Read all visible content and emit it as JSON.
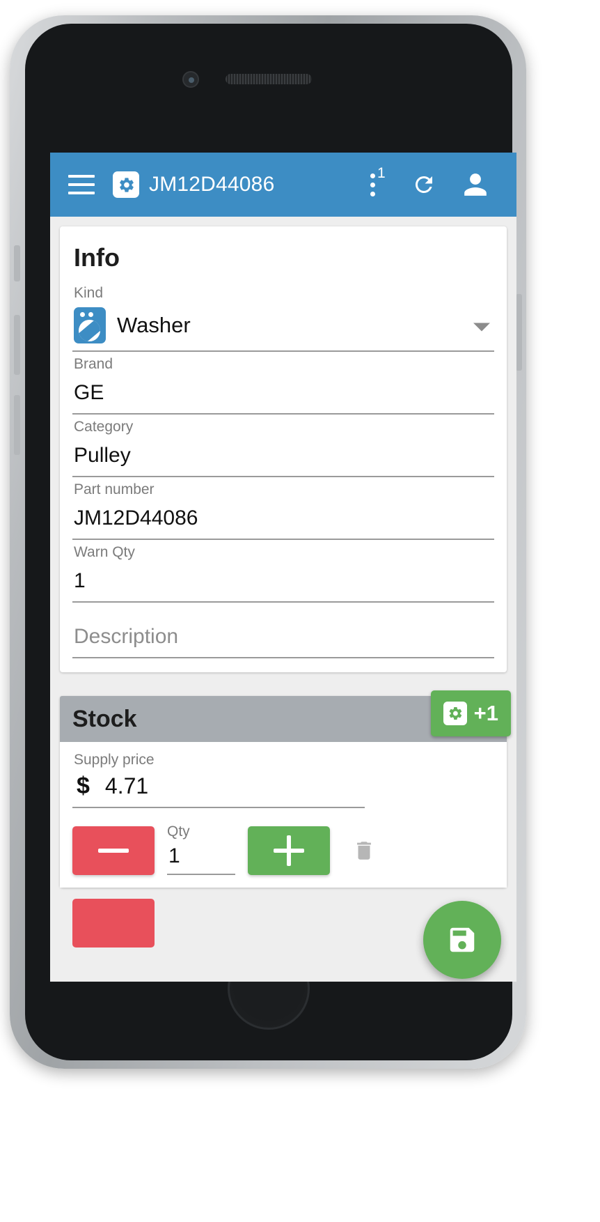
{
  "appbar": {
    "menu_icon": "hamburger-icon",
    "app_icon": "gear-icon",
    "title": "JM12D44086",
    "overflow_icon": "three-dots-icon",
    "overflow_badge": "1",
    "refresh_icon": "refresh-icon",
    "account_icon": "person-icon",
    "background_color": "#3d8dc4"
  },
  "info_card": {
    "title": "Info",
    "fields": [
      {
        "label": "Kind",
        "value": "Washer",
        "icon": "washer-icon",
        "type": "dropdown"
      },
      {
        "label": "Brand",
        "value": "GE",
        "type": "text"
      },
      {
        "label": "Category",
        "value": "Pulley",
        "type": "text"
      },
      {
        "label": "Part number",
        "value": "JM12D44086",
        "type": "text"
      },
      {
        "label": "Warn Qty",
        "value": "1",
        "type": "text"
      }
    ],
    "description_placeholder": "Description",
    "description_value": ""
  },
  "stock_card": {
    "title": "Stock",
    "add_button_label": "+1",
    "add_button_icon": "gear-icon",
    "add_button_color": "#62b158",
    "header_color": "#a7acb1",
    "supply_price_label": "Supply price",
    "currency_symbol": "$",
    "supply_price_value": "4.71",
    "qty_label": "Qty",
    "qty_value": "1",
    "decrement_label": "−",
    "increment_label": "+",
    "decrement_color": "#e8505b",
    "increment_color": "#62b158",
    "delete_icon": "trash-icon"
  },
  "fab": {
    "icon": "save-icon",
    "color": "#62b158"
  }
}
